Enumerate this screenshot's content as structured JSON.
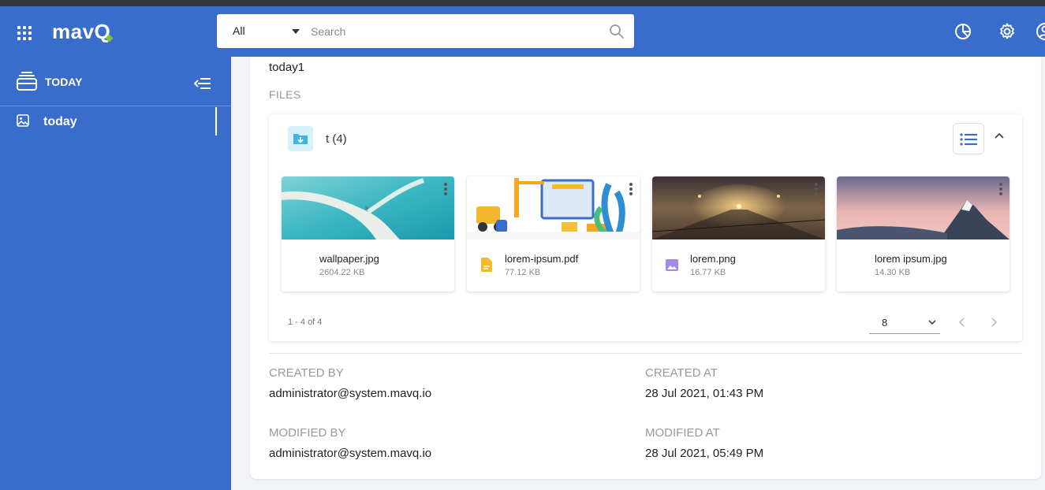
{
  "app": {
    "logo_text": "mav",
    "logo_accent": "Q",
    "brand_color": "#3a6ccc",
    "accent_color": "#7cc242"
  },
  "search": {
    "scope": "All",
    "placeholder": "Search"
  },
  "header_icons": [
    "apps-grid-icon",
    "pie-chart-icon",
    "gear-icon",
    "user-account-icon"
  ],
  "sidebar": {
    "section_title": "TODAY",
    "items": [
      {
        "label": "today",
        "icon": "image-icon",
        "active": true
      }
    ]
  },
  "record": {
    "name": "today1",
    "files_label": "FILES"
  },
  "folder": {
    "name": "t (4)"
  },
  "files": [
    {
      "name": "wallpaper.jpg",
      "size": "2604.22 KB",
      "icon": "none"
    },
    {
      "name": "lorem-ipsum.pdf",
      "size": "77.12 KB",
      "icon": "document-icon"
    },
    {
      "name": "lorem.png",
      "size": "16.77 KB",
      "icon": "image-file-icon"
    },
    {
      "name": "lorem ipsum.jpg",
      "size": "14.30 KB",
      "icon": "none"
    }
  ],
  "pagination": {
    "range": "1 - 4 of 4",
    "per_page": "8"
  },
  "meta": {
    "created_by_label": "CREATED BY",
    "created_by": "administrator@system.mavq.io",
    "created_at_label": "CREATED AT",
    "created_at": "28 Jul 2021, 01:43 PM",
    "modified_by_label": "MODIFIED BY",
    "modified_by": "administrator@system.mavq.io",
    "modified_at_label": "MODIFIED AT",
    "modified_at": "28 Jul 2021, 05:49 PM"
  }
}
